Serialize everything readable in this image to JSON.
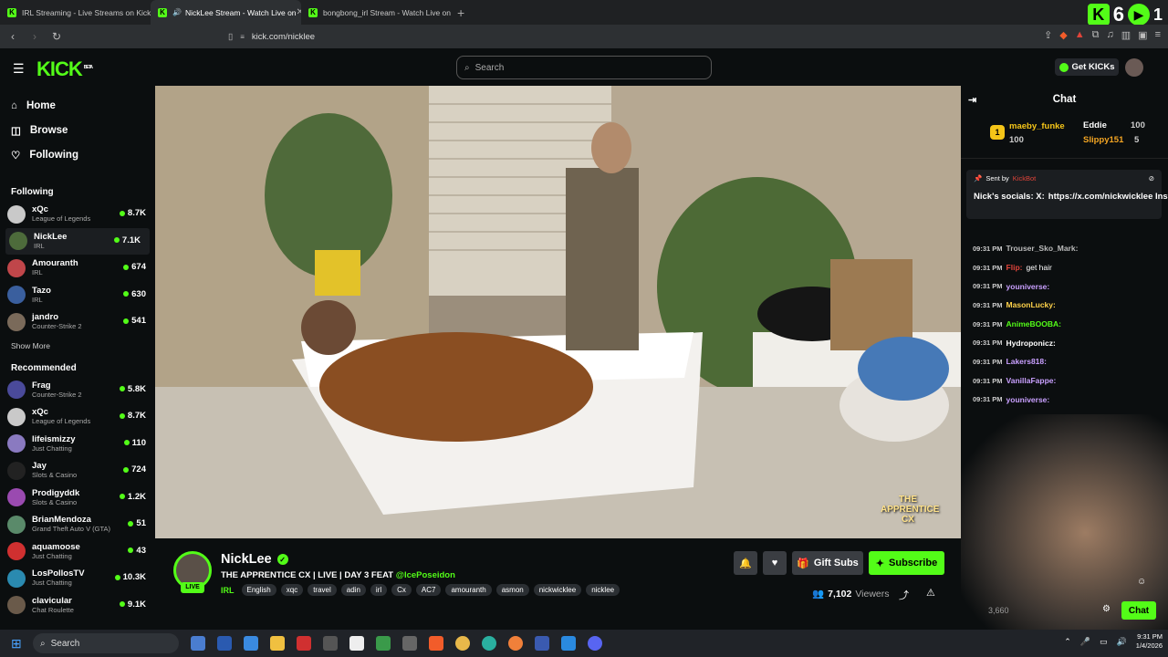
{
  "browser": {
    "tabs": [
      {
        "label": "IRL Streaming - Live Streams on Kick",
        "active": false
      },
      {
        "label": "NickLee Stream - Watch Live on",
        "active": true
      },
      {
        "label": "bongbong_irl Stream - Watch Live on",
        "active": false
      }
    ],
    "new_tab": "+",
    "url": "kick.com/nicklee",
    "watermark_count": "6",
    "watermark_extra": "1"
  },
  "header": {
    "logo": "KICK",
    "logo_badge": "BETA",
    "search_placeholder": "Search",
    "get_kicks": "Get KICKs"
  },
  "sidebar": {
    "nav": [
      {
        "label": "Home",
        "icon": "home-icon",
        "glyph": "⌂"
      },
      {
        "label": "Browse",
        "icon": "browse-icon",
        "glyph": "◫"
      },
      {
        "label": "Following",
        "icon": "heart-icon",
        "glyph": "♡"
      }
    ],
    "following_title": "Following",
    "following": [
      {
        "name": "xQc",
        "category": "League of Legends",
        "viewers": "8.7K",
        "color": "#c9c9c9"
      },
      {
        "name": "NickLee",
        "category": "IRL",
        "viewers": "7.1K",
        "color": "#4d6b3b",
        "selected": true
      },
      {
        "name": "Amouranth",
        "category": "IRL",
        "viewers": "674",
        "color": "#c0464a"
      },
      {
        "name": "Tazo",
        "category": "IRL",
        "viewers": "630",
        "color": "#3a5f9e"
      },
      {
        "name": "jandro",
        "category": "Counter-Strike 2",
        "viewers": "541",
        "color": "#7a6a5a"
      }
    ],
    "show_more": "Show More",
    "recommended_title": "Recommended",
    "recommended": [
      {
        "name": "Frag",
        "category": "Counter-Strike 2",
        "viewers": "5.8K",
        "color": "#4a4a9a"
      },
      {
        "name": "xQc",
        "category": "League of Legends",
        "viewers": "8.7K",
        "color": "#c9c9c9"
      },
      {
        "name": "lifeismizzy",
        "category": "Just Chatting",
        "viewers": "110",
        "color": "#8a7ac0"
      },
      {
        "name": "Jay",
        "category": "Slots & Casino",
        "viewers": "724",
        "color": "#222"
      },
      {
        "name": "Prodigyddk",
        "category": "Slots & Casino",
        "viewers": "1.2K",
        "color": "#9a4ab0"
      },
      {
        "name": "BrianMendoza",
        "category": "Grand Theft Auto V (GTA)",
        "viewers": "51",
        "color": "#5a8a6a"
      },
      {
        "name": "aquamoose",
        "category": "Just Chatting",
        "viewers": "43",
        "color": "#d03030"
      },
      {
        "name": "LosPollosTV",
        "category": "Just Chatting",
        "viewers": "10.3K",
        "color": "#2a8ab0"
      },
      {
        "name": "clavicular",
        "category": "Chat Roulette",
        "viewers": "9.1K",
        "color": "#6a5a4a"
      }
    ]
  },
  "stream": {
    "name": "NickLee",
    "live": "LIVE",
    "title_parts": [
      "THE APPRENTICE CX",
      "LIVE",
      "DAY 3 FEAT"
    ],
    "mention": "@IcePoseidon",
    "category": "IRL",
    "tags": [
      "English",
      "xqc",
      "travel",
      "adin",
      "irl",
      "Cx",
      "AC7",
      "amouranth",
      "asmon",
      "nickwicklee",
      "nicklee"
    ],
    "gift_subs": "Gift Subs",
    "subscribe": "Subscribe",
    "viewers_count": "7,102",
    "viewers_label": "Viewers",
    "overlay_text": "THE APPRENTICE CX"
  },
  "chat": {
    "title": "Chat",
    "leaderboard": [
      {
        "rank": "1",
        "name": "maeby_funke",
        "amount": "100"
      },
      {
        "name": "Eddie",
        "amount": "100"
      },
      {
        "name": "Slippy151",
        "amount": "5"
      }
    ],
    "pinned": {
      "sent_by": "Sent by",
      "bot": "KickBot",
      "line1": "Nick's socials: X:",
      "line2": "https://x.com/nickwicklee Insta:..."
    },
    "messages": [
      {
        "time": "09:31 PM",
        "user": "Trouser_Sko_Mark:",
        "text": "",
        "color": "#bbbbbb"
      },
      {
        "time": "09:31 PM",
        "user": "Flip:",
        "text": "get hair",
        "color": "#e0443a"
      },
      {
        "time": "09:31 PM",
        "user": "youniverse:",
        "text": "",
        "color": "#c9a0ff"
      },
      {
        "time": "09:31 PM",
        "user": "MasonLucky:",
        "text": "",
        "color": "#ffd24a"
      },
      {
        "time": "09:31 PM",
        "user": "AnimeBOOBA:",
        "text": "",
        "color": "#53fc18"
      },
      {
        "time": "09:31 PM",
        "user": "Hydroponicz:",
        "text": "",
        "color": "#ffffff"
      },
      {
        "time": "09:31 PM",
        "user": "Lakers818:",
        "text": "",
        "color": "#c9a0ff"
      },
      {
        "time": "09:31 PM",
        "user": "VanillaFappe:",
        "text": "",
        "color": "#c9a0ff"
      },
      {
        "time": "09:31 PM",
        "user": "youniverse:",
        "text": "",
        "color": "#c9a0ff"
      },
      {
        "time": "09:31 PM",
        "user": "",
        "text": "",
        "color": "#888888"
      }
    ],
    "chat_button": "Chat",
    "cam_count": "3,660"
  },
  "taskbar": {
    "search": "Search",
    "time": "9:31 PM",
    "date": "1/4/2026"
  }
}
